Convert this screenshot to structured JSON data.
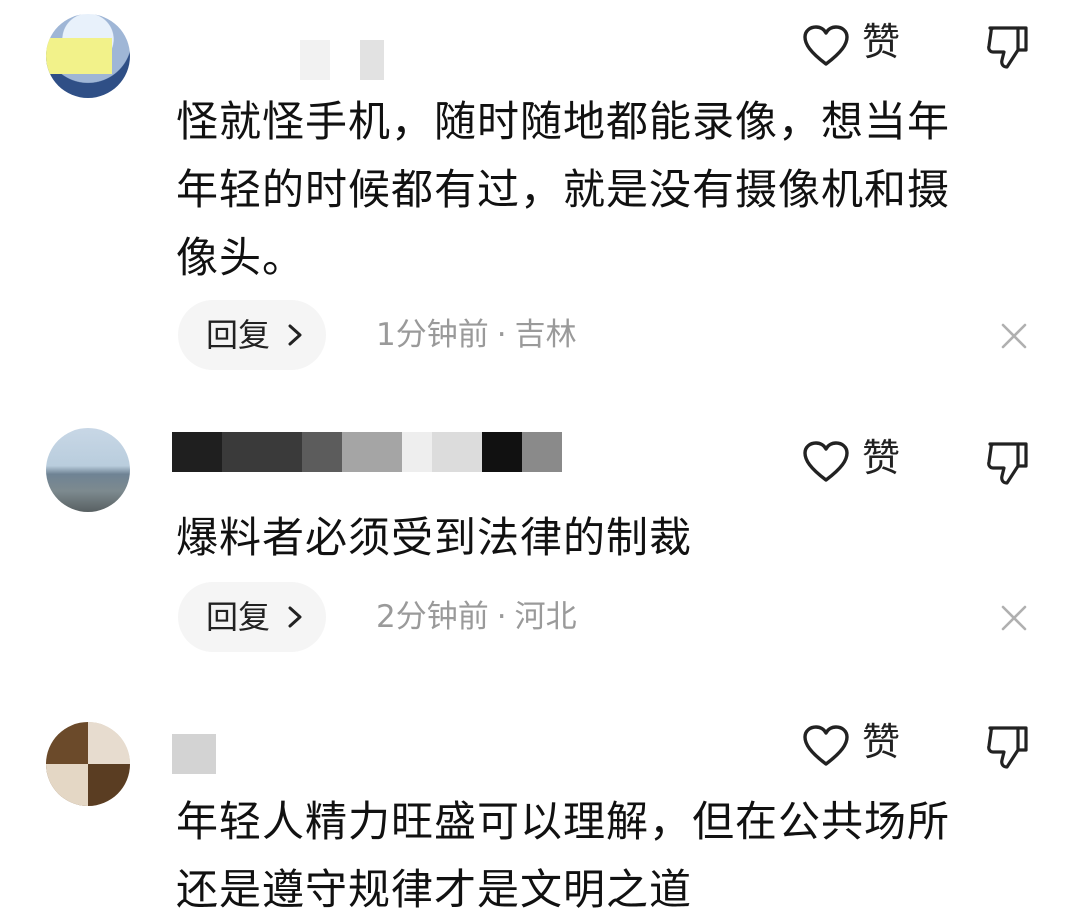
{
  "comments": [
    {
      "like_label": "赞",
      "text": "怪就怪手机，随时随地都能录像，想当年\n年轻的时候都有过，就是没有摄像机和摄\n像头。",
      "reply_label": "回复",
      "time": "1分钟前",
      "location": "吉林"
    },
    {
      "like_label": "赞",
      "text": "爆料者必须受到法律的制裁",
      "reply_label": "回复",
      "time": "2分钟前",
      "location": "河北"
    },
    {
      "like_label": "赞",
      "text": "年轻人精力旺盛可以理解，但在公共场所\n还是遵守规律才是文明之道"
    }
  ],
  "separator": "·",
  "icons": {
    "like": "heart-outline-icon",
    "dislike": "thumbs-down-outline-icon",
    "reply_arrow": "chevron-right-icon",
    "close": "close-icon"
  },
  "colors": {
    "text": "#111111",
    "meta": "#9a9a9a",
    "pill": "#f5f5f5"
  }
}
